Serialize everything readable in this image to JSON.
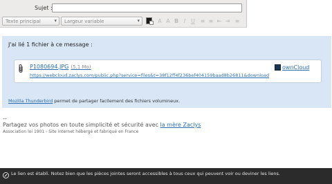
{
  "header": {
    "subject_label": "Sujet :",
    "subject_value": ""
  },
  "toolbar": {
    "paragraph_format": "Texte principal",
    "font": "Largeur variable",
    "text_color": "#1a1a1a"
  },
  "notice": {
    "title": "J'ai lié 1 fichier à ce message :",
    "attachment": {
      "filename": "P1080694.JPG",
      "size": "(5,1 Mo)",
      "url": "https://webcloud.zaclys.com/public.php?service=files&t=38f12ff4f236bef404159baad8b26811&download",
      "provider": "ownCloud"
    },
    "footer_link": "Mozilla Thunderbird",
    "footer_text": " permet de partager facilement des fichiers volumineux."
  },
  "signature": {
    "dashes": "--",
    "line1_text": "Partagez vos photos en toute simplicité et sécurité avec ",
    "line1_link": "la mère Zaclys",
    "line2": "Association loi 1901 - Site internet hébergé et fabriqué en France"
  },
  "statusbar": {
    "text": "Le lien est établi. Notez bien que les pièces jointes seront accessibles à tous ceux qui peuvent voir ou deviner les liens."
  },
  "colors": {
    "notice_bg": "#d9e6f5",
    "link": "#2b6db0",
    "statusbar_bg": "#2b2b2b"
  }
}
